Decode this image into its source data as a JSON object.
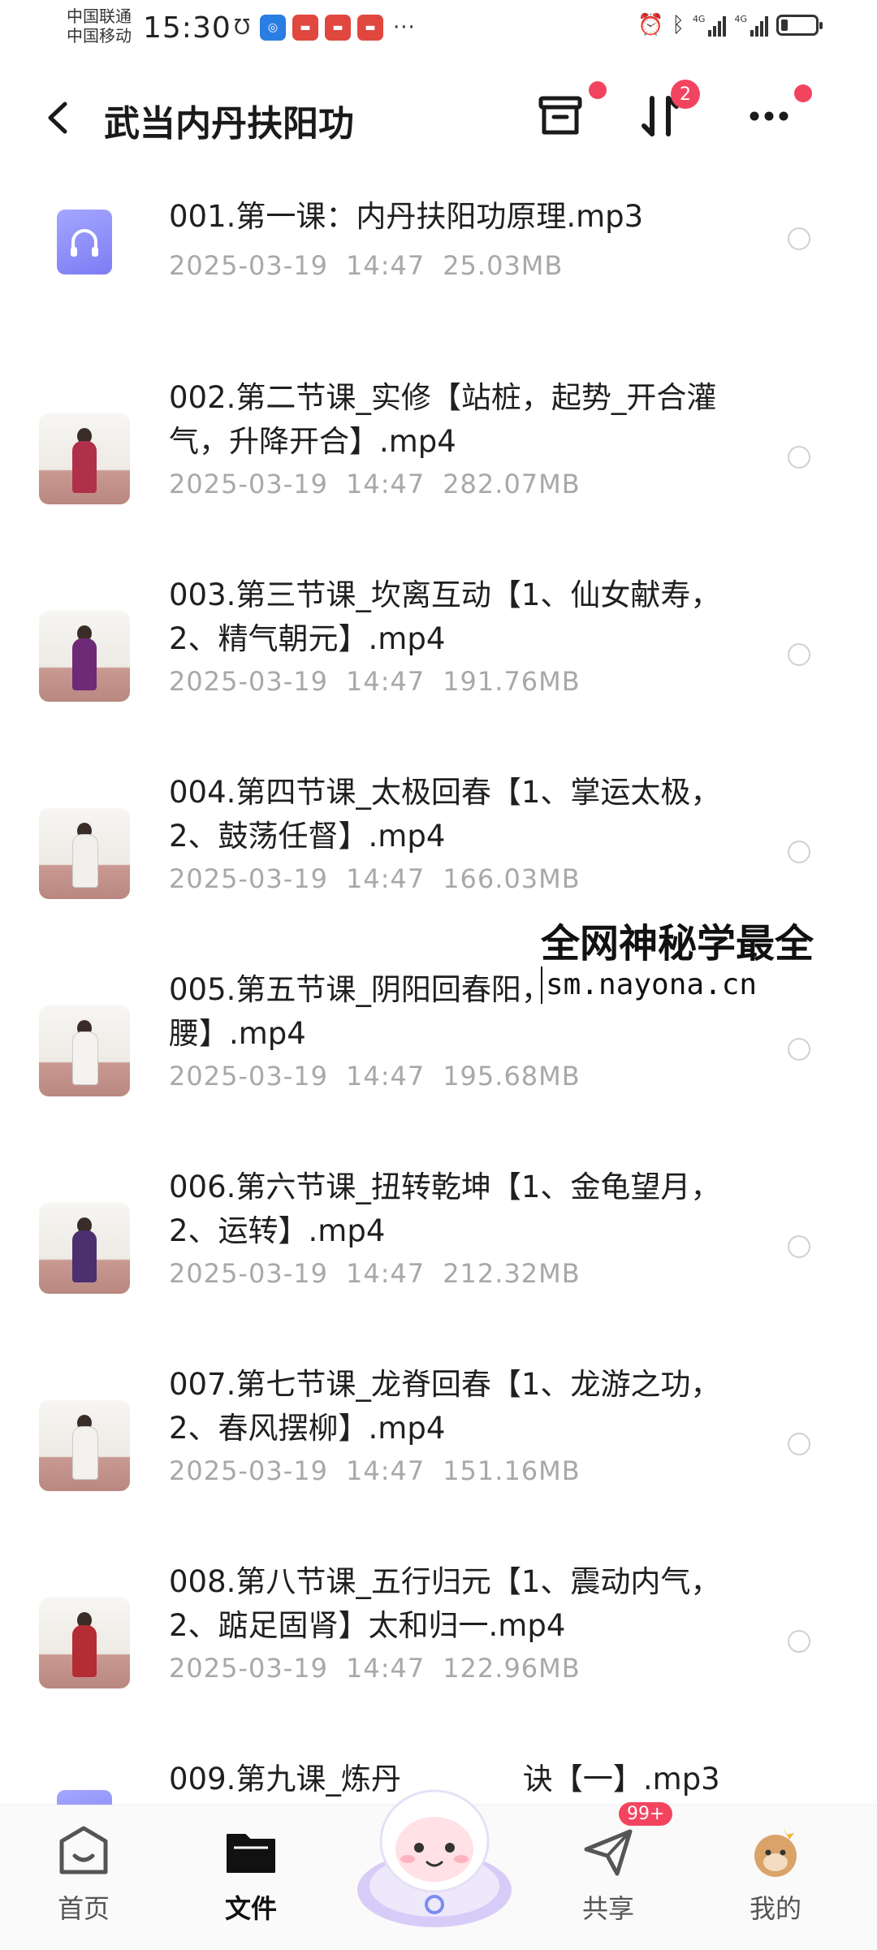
{
  "status_bar": {
    "carrier_1": "中国联通",
    "carrier_2": "中国移动",
    "time": "15:30",
    "network_1": "4G",
    "network_2": "4G",
    "notification_overflow": "···"
  },
  "header": {
    "title": "武当内丹扶阳功",
    "sort_badge": "2",
    "colors": {
      "badge": "#f3445f"
    }
  },
  "files": [
    {
      "name": "001.第一课：内丹扶阳功原理.mp3",
      "date": "2025-03-19",
      "time": "14:47",
      "size": "25.03MB",
      "kind": "audio"
    },
    {
      "name": "002.第二节课_实修【站桩，起势_开合灌气，升降开合】.mp4",
      "date": "2025-03-19",
      "time": "14:47",
      "size": "282.07MB",
      "kind": "video"
    },
    {
      "name": "003.第三节课_坎离互动【1、仙女献寿，2、精气朝元】.mp4",
      "date": "2025-03-19",
      "time": "14:47",
      "size": "191.76MB",
      "kind": "video"
    },
    {
      "name": "004.第四节课_太极回春【1、掌运太极，2、鼓荡任督】.mp4",
      "date": "2025-03-19",
      "time": "14:47",
      "size": "166.03MB",
      "kind": "video"
    },
    {
      "name": "005.第五节课_阴阳回春阳，2、塌腰凸腰】.mp4",
      "date": "2025-03-19",
      "time": "14:47",
      "size": "195.68MB",
      "kind": "video"
    },
    {
      "name": "006.第六节课_扭转乾坤【1、金龟望月，2、运转】.mp4",
      "date": "2025-03-19",
      "time": "14:47",
      "size": "212.32MB",
      "kind": "video"
    },
    {
      "name": "007.第七节课_龙脊回春【1、龙游之功，2、春风摆柳】.mp4",
      "date": "2025-03-19",
      "time": "14:47",
      "size": "151.16MB",
      "kind": "video"
    },
    {
      "name": "008.第八节课_五行归元【1、震动内气，2、踮足固肾】太和归一.mp4",
      "date": "2025-03-19",
      "time": "14:47",
      "size": "122.96MB",
      "kind": "video"
    },
    {
      "name": "009.第九课_炼丹",
      "name_tail": "诀【一】.mp3",
      "kind": "audio"
    }
  ],
  "watermark": {
    "line1": "全网神秘学最全",
    "line2": "sm.nayona.cn"
  },
  "bottom_nav": {
    "items": [
      {
        "label": "首页",
        "icon": "home-icon",
        "active": false
      },
      {
        "label": "文件",
        "icon": "folder-icon",
        "active": true
      },
      {
        "label": "共享",
        "icon": "send-icon",
        "active": false,
        "badge": "99+"
      },
      {
        "label": "我的",
        "icon": "avatar-icon",
        "active": false
      }
    ]
  }
}
